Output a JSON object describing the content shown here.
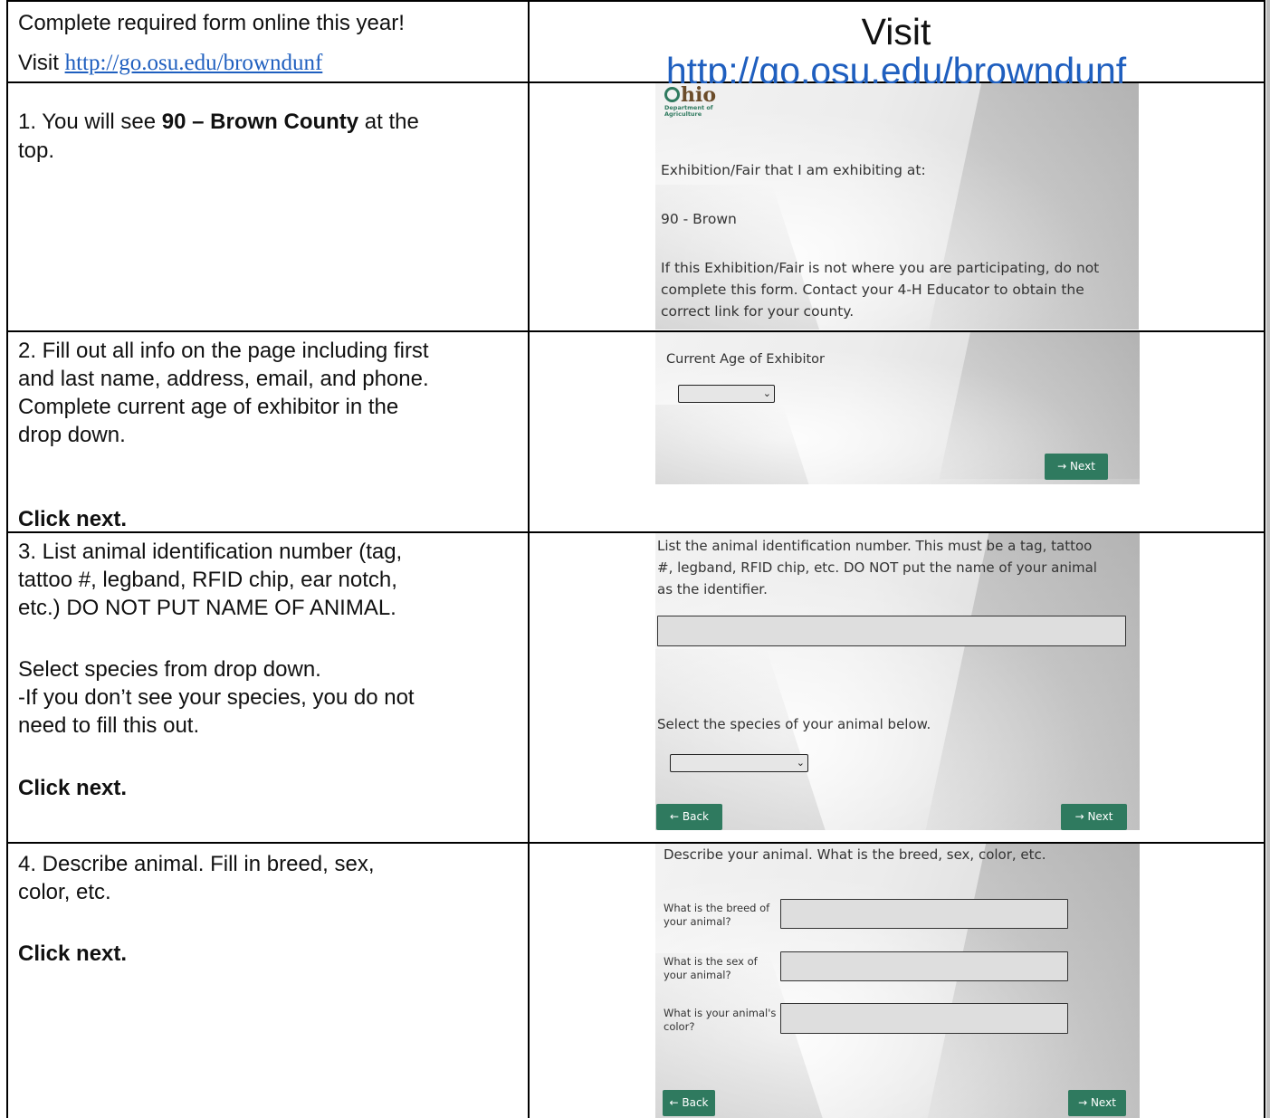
{
  "header": {
    "left_line1": "Complete required form online this year!",
    "left_visit": "Visit ",
    "left_link": "http://go.osu.edu/browndunf",
    "right_visit": "Visit",
    "right_link": "http://go.osu.edu/browndunf"
  },
  "step1": {
    "num": "1. You will see ",
    "bold": "90 – Brown County",
    "after": " at the",
    "line2": "top.",
    "screenshot": {
      "logo_text": "hio",
      "logo_dept1": "Department of",
      "logo_dept2": "Agriculture",
      "label": "Exhibition/Fair that I am exhibiting at:",
      "value": "90 - Brown",
      "note1": "If this Exhibition/Fair is not where you are participating, do not",
      "note2": "complete this form.  Contact your 4-H Educator to obtain the",
      "note3": "correct link for your county."
    }
  },
  "step2": {
    "line1": "2. Fill out all info on the page including first",
    "line2": "and last name, address, email, and phone.",
    "line3": "Complete current age of exhibitor in the",
    "line4": "drop down.",
    "click": "Click next.",
    "screenshot": {
      "label": "Current Age of Exhibitor",
      "next": "→  Next"
    }
  },
  "step3": {
    "line1": "3. List animal identification number (tag,",
    "line2": "tattoo #, legband, RFID chip, ear notch,",
    "line3": "etc.)  DO NOT PUT NAME OF ANIMAL.",
    "line4": "Select species from drop down.",
    "line5": "-If you don’t see your species, you do not",
    "line6": "need to fill this out.",
    "click": "Click next.",
    "screenshot": {
      "text1": "List the animal identification number.  This must be a tag, tattoo",
      "text2": "#, legband, RFID chip, etc.  DO NOT put the name of your animal",
      "text3": "as the identifier.",
      "species_label": "Select the species of your animal below.",
      "back": "←  Back",
      "next": "→  Next"
    }
  },
  "step4": {
    "line1": "4. Describe animal.  Fill in breed, sex,",
    "line2": "color, etc.",
    "click": "Click next.",
    "screenshot": {
      "title": "Describe your animal.  What is the breed, sex, color, etc.",
      "breed_l1": "What is the breed of",
      "breed_l2": "your animal?",
      "sex_l1": "What is the sex of",
      "sex_l2": "your animal?",
      "color_l1": "What is your animal's",
      "color_l2": "color?",
      "back": "←  Back",
      "next": "→  Next"
    }
  }
}
